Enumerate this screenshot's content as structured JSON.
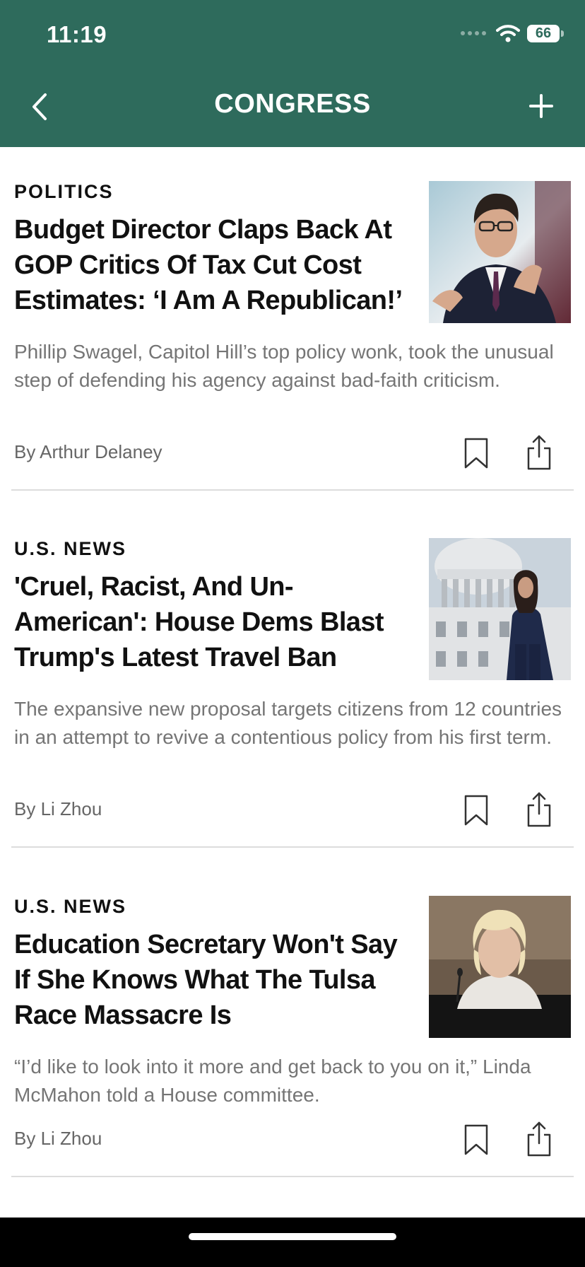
{
  "status_bar": {
    "time": "11:19",
    "battery": "66"
  },
  "nav": {
    "title": "CONGRESS"
  },
  "articles": [
    {
      "category": "POLITICS",
      "headline": "Budget Director Claps Back At GOP Critics Of Tax Cut Cost Estimates: ‘I Am A Republican!’",
      "summary": "Phillip Swagel, Capitol Hill’s top policy wonk, took the unusual step of defending his agency against bad-faith criticism.",
      "byline": "By Arthur Delaney"
    },
    {
      "category": "U.S. NEWS",
      "headline": "'Cruel, Racist, And Un-American': House Dems Blast Trump's Latest Travel Ban",
      "summary": "The expansive new proposal targets citizens from 12 countries in an attempt to revive a contentious policy from his first term.",
      "byline": "By Li Zhou"
    },
    {
      "category": "U.S. NEWS",
      "headline": "Education Secretary Won't Say If She Knows What The Tulsa Race Massacre Is",
      "summary": "“I’d like to look into it more and get back to you on it,” Linda McMahon told a House committee.",
      "byline": "By Li Zhou"
    }
  ],
  "colors": {
    "header": "#2e6b5c",
    "text": "#111111",
    "muted": "#757575"
  },
  "icons": {
    "back": "chevron-left-icon",
    "add": "plus-icon",
    "bookmark": "bookmark-icon",
    "share": "share-icon"
  }
}
